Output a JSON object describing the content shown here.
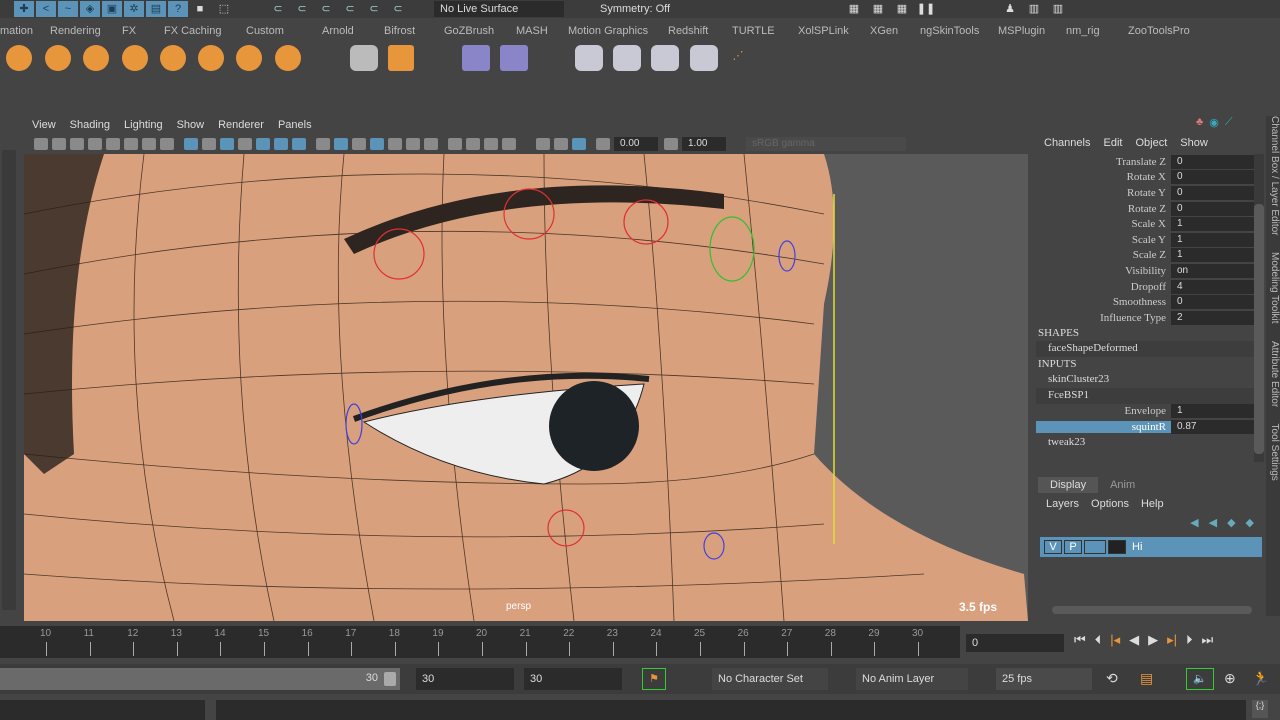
{
  "status_line": {
    "live_surface": "No Live Surface",
    "symmetry": "Symmetry: Off"
  },
  "shelf_tabs": [
    "mation",
    "Rendering",
    "FX",
    "FX Caching",
    "Custom",
    "Arnold",
    "Bifrost",
    "GoZBrush",
    "MASH",
    "Motion Graphics",
    "Redshift",
    "TURTLE",
    "XolSPLink",
    "XGen",
    "ngSkinTools",
    "MSPlugin",
    "nm_rig",
    "ZooToolsPro"
  ],
  "viewport": {
    "menu": [
      "View",
      "Shading",
      "Lighting",
      "Show",
      "Renderer",
      "Panels"
    ],
    "exposure": "0.00",
    "gamma": "1.00",
    "color_space": "sRGB gamma",
    "camera_label": "persp",
    "fps_readout": "3.5 fps"
  },
  "channel_box": {
    "menu": [
      "Channels",
      "Edit",
      "Object",
      "Show"
    ],
    "side_tabs": [
      "Channel Box / Layer Editor",
      "Modeling Toolkit",
      "Attribute Editor",
      "Tool Settings"
    ],
    "channels": [
      {
        "label": "Translate Z",
        "value": "0"
      },
      {
        "label": "Rotate X",
        "value": "0"
      },
      {
        "label": "Rotate Y",
        "value": "0"
      },
      {
        "label": "Rotate Z",
        "value": "0"
      },
      {
        "label": "Scale X",
        "value": "1"
      },
      {
        "label": "Scale Y",
        "value": "1"
      },
      {
        "label": "Scale Z",
        "value": "1"
      },
      {
        "label": "Visibility",
        "value": "on"
      },
      {
        "label": "Dropoff",
        "value": "4"
      },
      {
        "label": "Smoothness",
        "value": "0"
      },
      {
        "label": "Influence Type",
        "value": "2"
      }
    ],
    "shapes_header": "SHAPES",
    "shape_node": "faceShapeDeformed",
    "inputs_header": "INPUTS",
    "input_nodes": [
      "skinCluster23",
      "FceBSP1"
    ],
    "input_channels": [
      {
        "label": "Envelope",
        "value": "1"
      },
      {
        "label": "squintR",
        "value": "0.87"
      }
    ],
    "last_node": "tweak23"
  },
  "layer_editor": {
    "tabs": [
      "Display",
      "Anim"
    ],
    "menu": [
      "Layers",
      "Options",
      "Help"
    ],
    "layer": {
      "v": "V",
      "p": "P",
      "name": "Hi"
    }
  },
  "timeline": {
    "ticks": [
      "10",
      "11",
      "12",
      "13",
      "14",
      "15",
      "16",
      "17",
      "18",
      "19",
      "20",
      "21",
      "22",
      "23",
      "24",
      "25",
      "26",
      "27",
      "28",
      "29",
      "30"
    ],
    "current_frame": "0"
  },
  "range": {
    "end_slider": "30",
    "playback_end": "30",
    "anim_end": "30",
    "character_set": "No Character Set",
    "anim_layer": "No Anim Layer",
    "fps": "25 fps"
  },
  "colors": {
    "accent": "#5b94b8",
    "skin": "#d9a07e",
    "panel": "#444444"
  }
}
